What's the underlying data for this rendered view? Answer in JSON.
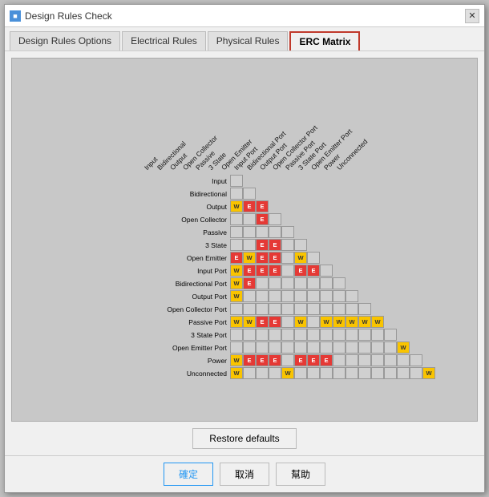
{
  "window": {
    "title": "Design Rules Check",
    "icon": "■",
    "close_label": "✕"
  },
  "tabs": [
    {
      "label": "Design Rules Options",
      "active": false
    },
    {
      "label": "Electrical Rules",
      "active": false
    },
    {
      "label": "Physical Rules",
      "active": false
    },
    {
      "label": "ERC Matrix",
      "active": true
    }
  ],
  "buttons": {
    "restore": "Restore defaults",
    "ok": "確定",
    "cancel": "取消",
    "help": "幫助"
  },
  "matrix": {
    "col_headers": [
      "Input",
      "Bidirectional",
      "Output",
      "Open Collector",
      "Passive",
      "3 State",
      "Open Emitter",
      "Input Port",
      "Bidirectional Port",
      "Output Port",
      "Open Collector Port",
      "Passive Port",
      "3 State Port",
      "Open Emitter Port",
      "Power",
      "Unconnected"
    ],
    "row_headers": [
      "Input",
      "Bidirectional",
      "Output",
      "Open Collector",
      "Passive",
      "3 State",
      "Open Emitter",
      "Input Port",
      "Bidirectional Port",
      "Output Port",
      "Open Collector Port",
      "Passive Port",
      "3 State Port",
      "Open Emitter Port",
      "Power",
      "Unconnected"
    ]
  }
}
